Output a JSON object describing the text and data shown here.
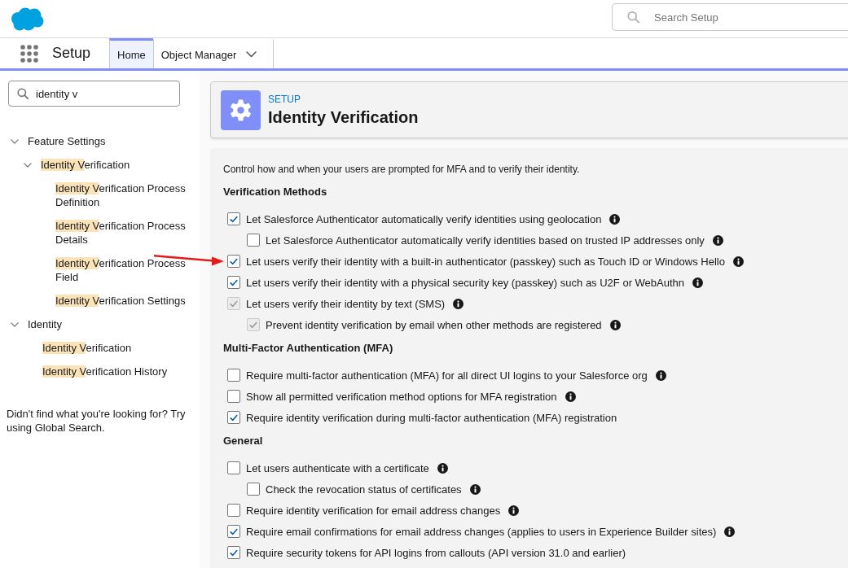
{
  "header": {
    "search": {
      "placeholder": "Search Setup"
    }
  },
  "nav": {
    "app_name": "Setup",
    "tabs": [
      {
        "label": "Home",
        "selected": true,
        "menu": false
      },
      {
        "label": "Object Manager",
        "selected": false,
        "menu": true
      }
    ]
  },
  "sidebar": {
    "quick_find": {
      "value": "identity v"
    },
    "tree": [
      {
        "text": "Feature Settings",
        "expanded": true,
        "children": [
          {
            "highlight": "Identity V",
            "text": "erification",
            "expanded": true,
            "children": [
              {
                "highlight": "Identity V",
                "text": "erification Process Definition"
              },
              {
                "highlight": "Identity V",
                "text": "erification Process Details"
              },
              {
                "highlight": "Identity V",
                "text": "erification Process Field"
              },
              {
                "highlight": "Identity V",
                "text": "erification Settings"
              }
            ]
          }
        ]
      },
      {
        "text": "Identity",
        "expanded": true,
        "children": [
          {
            "highlight": "Identity V",
            "text": "erification"
          },
          {
            "highlight": "Identity V",
            "text": "erification History"
          }
        ]
      }
    ],
    "help_text": "Didn't find what you're looking for? Try using Global Search."
  },
  "page_header": {
    "eyebrow": "SETUP",
    "title": "Identity Verification"
  },
  "content": {
    "description": "Control how and when your users are prompted for MFA and to verify their identity.",
    "sections": [
      {
        "heading": "Verification Methods",
        "options": [
          {
            "label": "Let Salesforce Authenticator automatically verify identities using geolocation",
            "checked": true,
            "disabled": false,
            "info": true,
            "pointer": false,
            "children": [
              {
                "label": "Let Salesforce Authenticator automatically verify identities based on trusted IP addresses only",
                "checked": false,
                "disabled": false,
                "info": true,
                "pointer": false
              }
            ]
          },
          {
            "label": "Let users verify their identity with a built-in authenticator (passkey) such as Touch ID or Windows Hello",
            "checked": true,
            "disabled": false,
            "info": true,
            "pointer": true
          },
          {
            "label": "Let users verify their identity with a physical security key (passkey) such as U2F or WebAuthn",
            "checked": true,
            "disabled": false,
            "info": true,
            "pointer": false
          },
          {
            "label": "Let users verify their identity by text (SMS)",
            "checked": true,
            "disabled": true,
            "info": true,
            "pointer": false,
            "children": [
              {
                "label": "Prevent identity verification by email when other methods are registered",
                "checked": true,
                "disabled": true,
                "info": true,
                "pointer": false
              }
            ]
          }
        ]
      },
      {
        "heading": "Multi-Factor Authentication (MFA)",
        "options": [
          {
            "label": "Require multi-factor authentication (MFA) for all direct UI logins to your Salesforce org",
            "checked": false,
            "disabled": false,
            "info": true,
            "pointer": false
          },
          {
            "label": "Show all permitted verification method options for MFA registration",
            "checked": false,
            "disabled": false,
            "info": true,
            "pointer": false
          },
          {
            "label": "Require identity verification during multi-factor authentication (MFA) registration",
            "checked": true,
            "disabled": false,
            "info": false,
            "pointer": false
          }
        ]
      },
      {
        "heading": "General",
        "options": [
          {
            "label": "Let users authenticate with a certificate",
            "checked": false,
            "disabled": false,
            "info": true,
            "pointer": false,
            "children": [
              {
                "label": "Check the revocation status of certificates",
                "checked": false,
                "disabled": false,
                "info": true,
                "pointer": false
              }
            ]
          },
          {
            "label": "Require identity verification for email address changes",
            "checked": false,
            "disabled": false,
            "info": true,
            "pointer": false
          },
          {
            "label": "Require email confirmations for email address changes (applies to users in Experience Builder sites)",
            "checked": true,
            "disabled": false,
            "info": true,
            "pointer": false
          },
          {
            "label": "Require security tokens for API logins from callouts (API version 31.0 and earlier)",
            "checked": true,
            "disabled": false,
            "info": false,
            "pointer": false
          }
        ]
      }
    ]
  }
}
